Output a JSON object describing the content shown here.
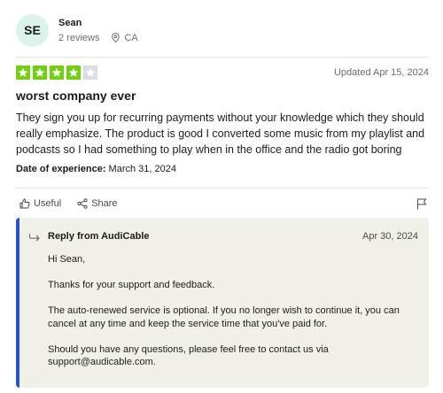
{
  "reviewer": {
    "initials": "SE",
    "name": "Sean",
    "reviews": "2 reviews",
    "location": "CA"
  },
  "rating": {
    "value": 4,
    "max": 5,
    "star_color": "#73cf11",
    "empty_color": "#dcdce6"
  },
  "updated": "Updated Apr 15, 2024",
  "review": {
    "title": "worst company ever",
    "body": "They sign you up for recurring payments without your knowledge which they should really emphasize. The product is good I converted some music from my playlist and podcasts so I had something to play when in the office and the radio got boring",
    "experience_label": "Date of experience:",
    "experience_date": "March 31, 2024"
  },
  "actions": {
    "useful": "Useful",
    "share": "Share"
  },
  "reply": {
    "from": "Reply from AudiCable",
    "date": "Apr 30, 2024",
    "paragraphs": [
      "Hi Sean,",
      "Thanks for your support and feedback.",
      "The auto-renewed service is optional. If you no longer wish to continue it, you can cancel at any time and keep the service time that you've paid for.",
      "Should you have any questions, please feel free to contact us via support@audicable.com."
    ],
    "accent_color": "#2b53c8"
  }
}
